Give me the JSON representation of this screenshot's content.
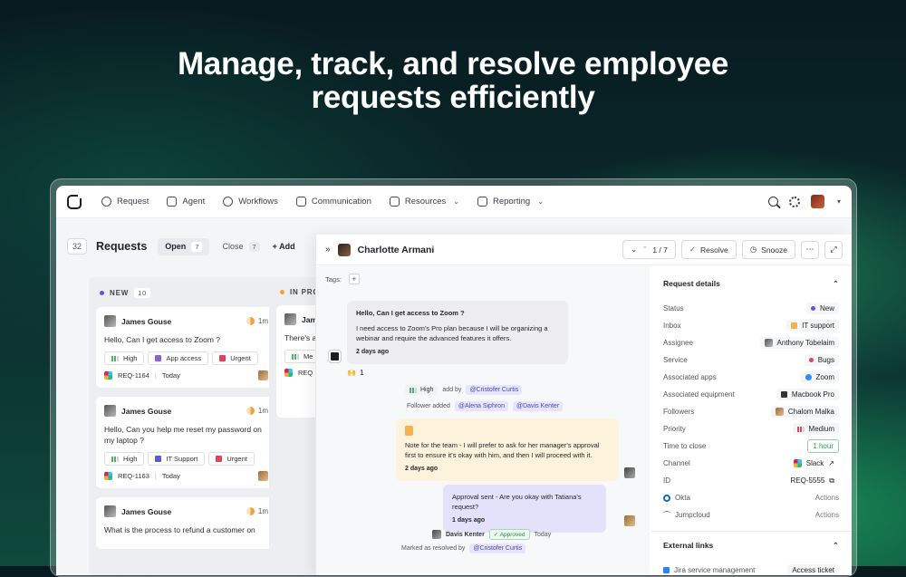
{
  "hero": {
    "line1": "Manage, track, and resolve employee",
    "line2": "requests efficiently"
  },
  "nav": {
    "items": [
      {
        "label": "Request"
      },
      {
        "label": "Agent"
      },
      {
        "label": "Workflows"
      },
      {
        "label": "Communication"
      },
      {
        "label": "Resources"
      },
      {
        "label": "Reporting"
      }
    ]
  },
  "requests": {
    "count": "32",
    "title": "Requests",
    "open_label": "Open",
    "open_count": "7",
    "close_label": "Close",
    "close_count": "7",
    "add_label": "+ Add"
  },
  "columns": {
    "new": {
      "label": "NEW",
      "count": "10",
      "color": "#5b5bd6"
    },
    "progress": {
      "label": "IN PROG",
      "color": "#f0a23a"
    }
  },
  "cards": [
    {
      "name": "James Gouse",
      "time": "1m",
      "message": "Hello, Can I get access to Zoom ?",
      "priority": "High",
      "category": "App access",
      "tag3": "Urgent",
      "id": "REQ-1164",
      "date": "Today"
    },
    {
      "name": "James Gouse",
      "time": "1m",
      "message": "Hello, Can you help me reset my password on my laptop ?",
      "priority": "High",
      "category": "IT Support",
      "tag3": "Urgent",
      "id": "REQ-1163",
      "date": "Today"
    },
    {
      "name": "James Gouse",
      "time": "1m",
      "message": "What is the process to refund a customer on"
    }
  ],
  "col2_cards": [
    {
      "name": "Jam",
      "message": "There's a",
      "tag": "Me",
      "id": "REQ"
    }
  ],
  "panel": {
    "name": "Charlotte Armani",
    "pager": "1 / 7",
    "resolve": "Resolve",
    "snooze": "Snooze",
    "tags_label": "Tags:"
  },
  "conversation": {
    "m1_title": "Hello, Can I get access to Zoom ?",
    "m1_body": "I need access to Zoom's Pro plan because I will be organizing a webinar and require the advanced features it offers.",
    "m1_time": "2 days ago",
    "reaction_count": "1",
    "act1_priority": "High",
    "act1_text": "add by",
    "act1_user": "@Cristofer Curtis",
    "act2_text": "Follower added",
    "act2_u1": "@Alena Siphron",
    "act2_u2": "@Davis Kenter",
    "note_body": "Note for the team - I will prefer to ask for her manager's approval first to ensure it's okay with him, and then I will proceed with it.",
    "note_time": "2 days ago",
    "m3_body": "Approval sent - Are you okay with Tatiana's request?",
    "m3_time": "1 days ago",
    "approver": "Davis Kenter",
    "approved": "Approved",
    "approved_time": "Today",
    "resolved_text": "Marked as resolved by",
    "resolved_user": "@Cristofer Curtis"
  },
  "details": {
    "title": "Request details",
    "rows": [
      {
        "label": "Status",
        "value": "New"
      },
      {
        "label": "Inbox",
        "value": "IT support"
      },
      {
        "label": "Assignee",
        "value": "Anthony Tobelaim"
      },
      {
        "label": "Service",
        "value": "Bugs"
      },
      {
        "label": "Associated apps",
        "value": "Zoom"
      },
      {
        "label": "Associated equipment",
        "value": "Macbook Pro"
      },
      {
        "label": "Followers",
        "value": "Chalom Malka"
      },
      {
        "label": "Priority",
        "value": "Medium"
      },
      {
        "label": "Time to close",
        "value": "1 hour"
      },
      {
        "label": "Channel",
        "value": "Slack"
      },
      {
        "label": "ID",
        "value": "REQ-5555"
      },
      {
        "label": "Okta",
        "value": "Actions"
      },
      {
        "label": "Jumpcloud",
        "value": "Actions"
      }
    ],
    "links_title": "External links",
    "link1": "Jira service management",
    "link1_action": "Access ticket"
  }
}
